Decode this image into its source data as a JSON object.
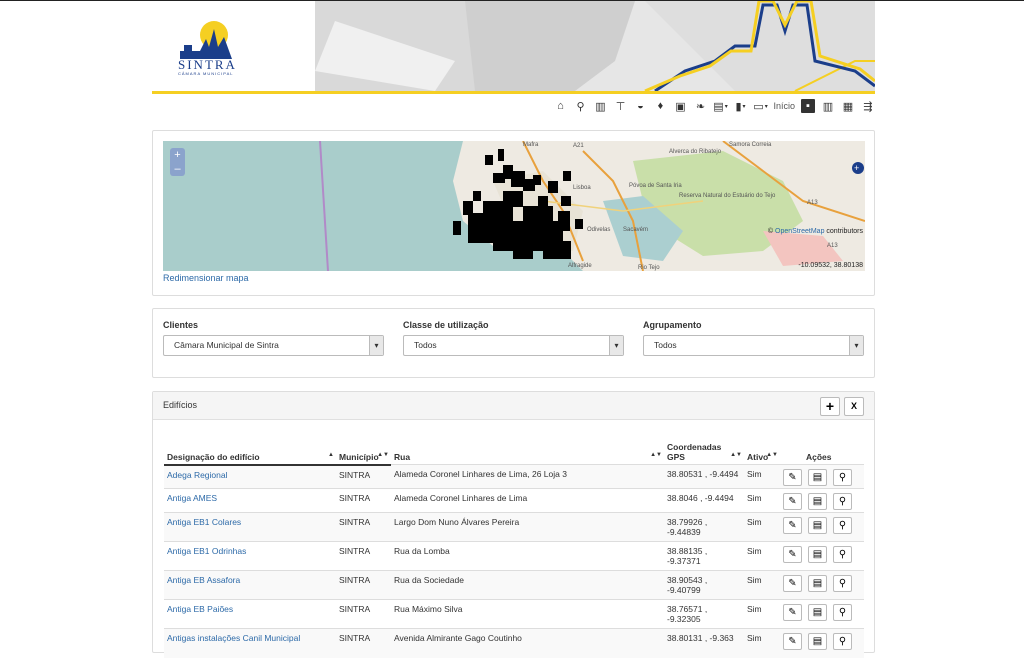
{
  "brand": {
    "name": "SINTRA",
    "subtitle": "CÂMARA MUNICIPAL"
  },
  "toolbar": {
    "icons": [
      "home-icon",
      "search-icon",
      "building-icon",
      "faucet-icon",
      "car-icon",
      "water-drop-icon",
      "bus-icon",
      "leaf-icon",
      "save-icon",
      "chart-icon",
      "folder-icon"
    ],
    "home_label": "Início"
  },
  "map": {
    "zoom_in": "+",
    "zoom_out": "–",
    "attribution_symbol": "©",
    "attribution_link": "OpenStreetMap",
    "attribution_suffix": " contributors",
    "coords": "-10.09532, 38.80138",
    "resize_label": "Redimensionar mapa",
    "place_labels": [
      "Mafra",
      "Alverca do Ribatejo",
      "Samora Correia",
      "Lisboa",
      "Póvoa de Santa Iria",
      "Reserva Natural do Estuário do Tejo",
      "Sacavém",
      "Odivelas",
      "Alfragide",
      "Rio Tejo",
      "A21",
      "A13",
      "A13"
    ]
  },
  "filters": [
    {
      "label": "Clientes",
      "value": "Câmara Municipal de Sintra"
    },
    {
      "label": "Classe de utilização",
      "value": "Todos"
    },
    {
      "label": "Agrupamento",
      "value": "Todos"
    }
  ],
  "table": {
    "title": "Edifícios",
    "add_label": "+",
    "export_label": "X",
    "columns": [
      "Designação do edifício",
      "Município",
      "Rua",
      "Coordenadas GPS",
      "Ativo",
      "Ações"
    ],
    "rows": [
      {
        "name": "Adega Regional",
        "municipio": "SINTRA",
        "rua": "Alameda Coronel Linhares de Lima, 26 Loja 3",
        "gps": "38.80531 , -9.4494",
        "ativo": "Sim"
      },
      {
        "name": "Antiga AMES",
        "municipio": "SINTRA",
        "rua": "Alameda Coronel Linhares de Lima",
        "gps": "38.8046 , -9.4494",
        "ativo": "Sim"
      },
      {
        "name": "Antiga EB1 Colares",
        "municipio": "SINTRA",
        "rua": "Largo Dom Nuno Álvares Pereira",
        "gps": "38.79926 , -9.44839",
        "ativo": "Sim"
      },
      {
        "name": "Antiga EB1 Odrinhas",
        "municipio": "SINTRA",
        "rua": "Rua da Lomba",
        "gps": "38.88135 , -9.37371",
        "ativo": "Sim"
      },
      {
        "name": "Antiga EB Assafora",
        "municipio": "SINTRA",
        "rua": "Rua da Sociedade",
        "gps": "38.90543 , -9.40799",
        "ativo": "Sim"
      },
      {
        "name": "Antiga EB Paiões",
        "municipio": "SINTRA",
        "rua": "Rua Máximo Silva",
        "gps": "38.76571 , -9.32305",
        "ativo": "Sim"
      },
      {
        "name": "Antigas instalações Canil Municipal",
        "municipio": "SINTRA",
        "rua": "Avenida Almirante Gago Coutinho",
        "gps": "38.80131 , -9.363",
        "ativo": "Sim"
      }
    ]
  },
  "colors": {
    "brand_yellow": "#f5cf22",
    "brand_blue": "#1b3e8a",
    "link": "#2d6aa8"
  }
}
